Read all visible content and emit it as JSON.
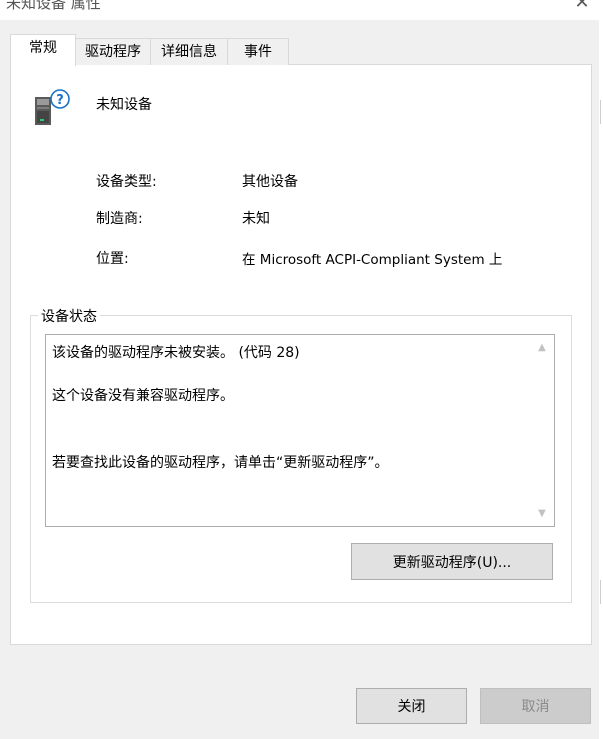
{
  "window": {
    "title": "未知设备 属性",
    "close_glyph": "✕"
  },
  "tabs": [
    {
      "label": "常规",
      "active": true
    },
    {
      "label": "驱动程序",
      "active": false
    },
    {
      "label": "详细信息",
      "active": false
    },
    {
      "label": "事件",
      "active": false
    }
  ],
  "device": {
    "icon": "unknown-device-icon",
    "name": "未知设备"
  },
  "properties": [
    {
      "label": "设备类型:",
      "value": "其他设备"
    },
    {
      "label": "制造商:",
      "value": "未知"
    },
    {
      "label": "位置:",
      "value": "在 Microsoft ACPI-Compliant System 上"
    }
  ],
  "status": {
    "group_label": "设备状态",
    "lines": [
      "该设备的驱动程序未被安装。 (代码 28)",
      "这个设备没有兼容驱动程序。",
      "若要查找此设备的驱动程序，请单击“更新驱动程序”。"
    ]
  },
  "buttons": {
    "update_driver": "更新驱动程序(U)...",
    "close": "关闭",
    "cancel": "取消"
  },
  "colors": {
    "dialog_bg": "#f0f0f0",
    "panel_bg": "#ffffff",
    "button_bg": "#e1e1e1",
    "icon_question": "#1a73c8"
  }
}
